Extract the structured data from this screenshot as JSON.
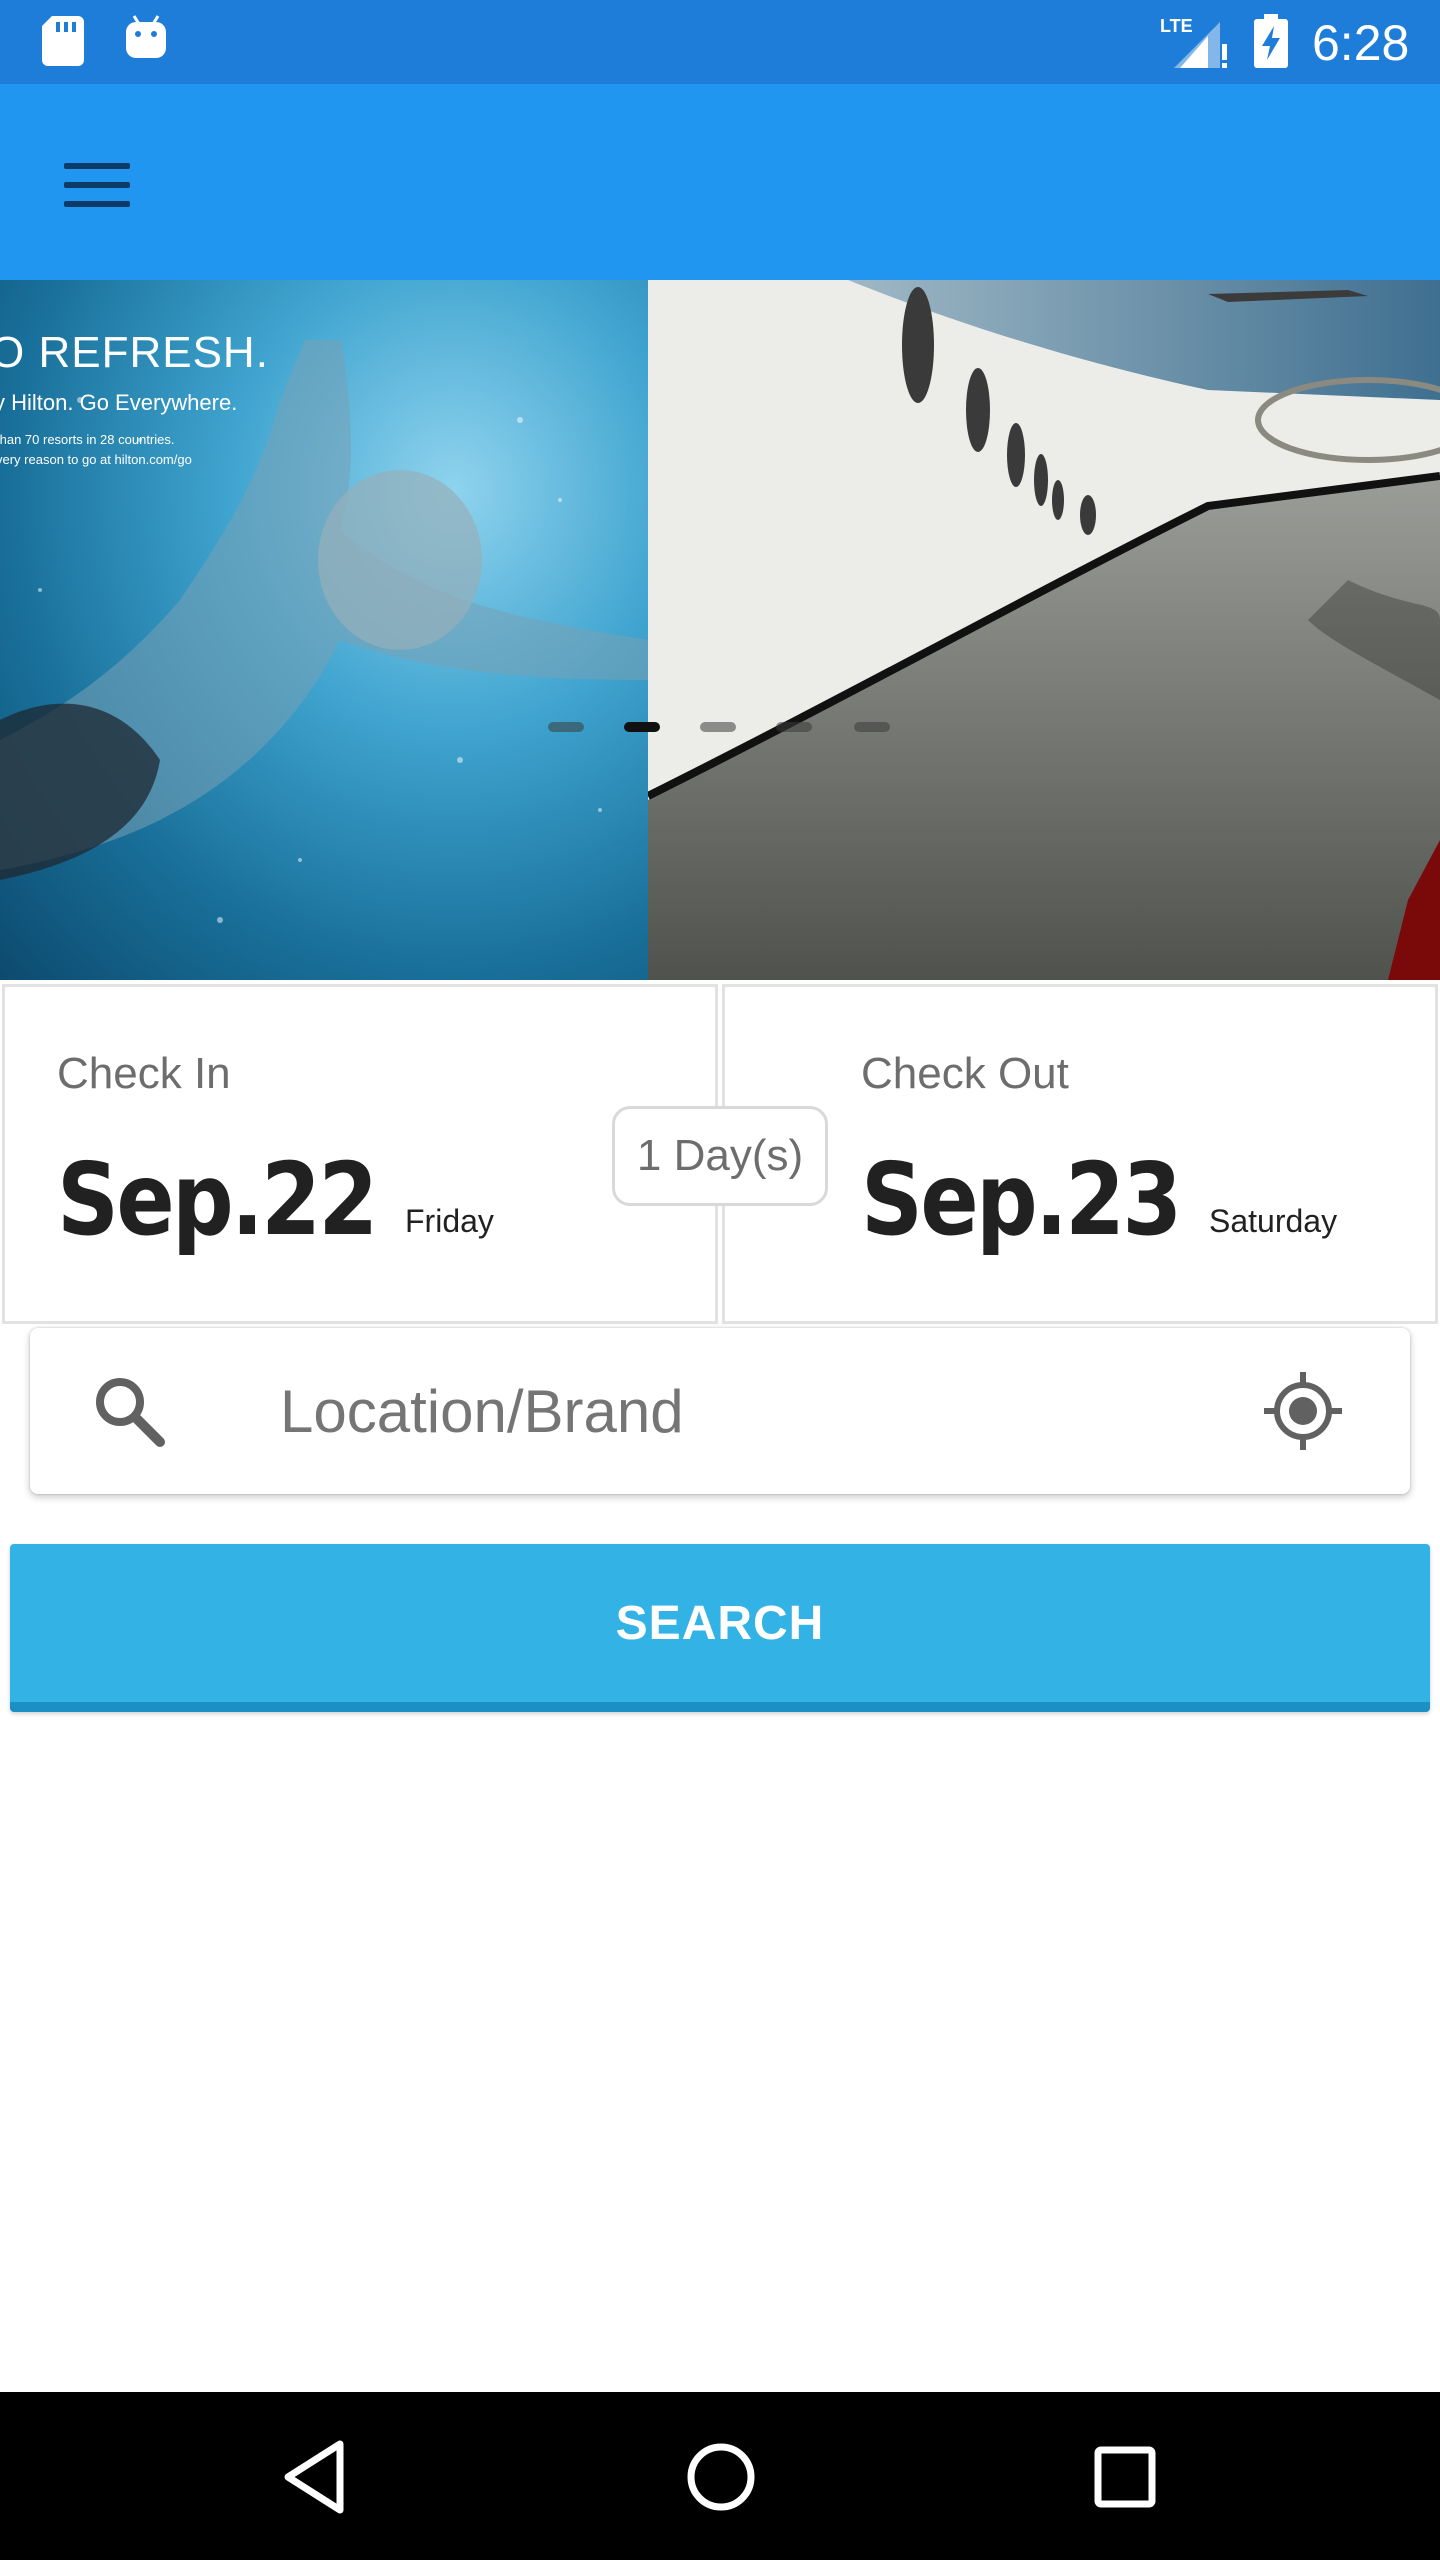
{
  "status_bar": {
    "time": "6:28",
    "network": "LTE",
    "icons": [
      "sd-card-icon",
      "android-icon",
      "lte-signal-icon",
      "battery-charging-icon"
    ]
  },
  "app_bar": {
    "menu_icon": "hamburger-menu-icon",
    "color": "#2196f0"
  },
  "carousel": {
    "slide_text": {
      "headline": "O REFRESH.",
      "tagline": "y Hilton. Go Everywhere.",
      "line1": "than 70 resorts in 28 countries.",
      "line2": "very reason to go at hilton.com/go"
    },
    "dot_count": 5,
    "active_index": 1
  },
  "dates": {
    "check_in": {
      "label": "Check In",
      "date": "Sep.22",
      "weekday": "Friday"
    },
    "check_out": {
      "label": "Check Out",
      "date": "Sep.23",
      "weekday": "Saturday"
    },
    "nights": "1 Day(s)"
  },
  "search": {
    "icon": "search-icon",
    "placeholder": "Location/Brand",
    "value": "",
    "locate_icon": "gps-locate-icon"
  },
  "search_button": {
    "label": "SEARCH",
    "color": "#33b3e5"
  },
  "nav_bar": {
    "icons": [
      "back-triangle-icon",
      "home-circle-icon",
      "recents-square-icon"
    ]
  }
}
